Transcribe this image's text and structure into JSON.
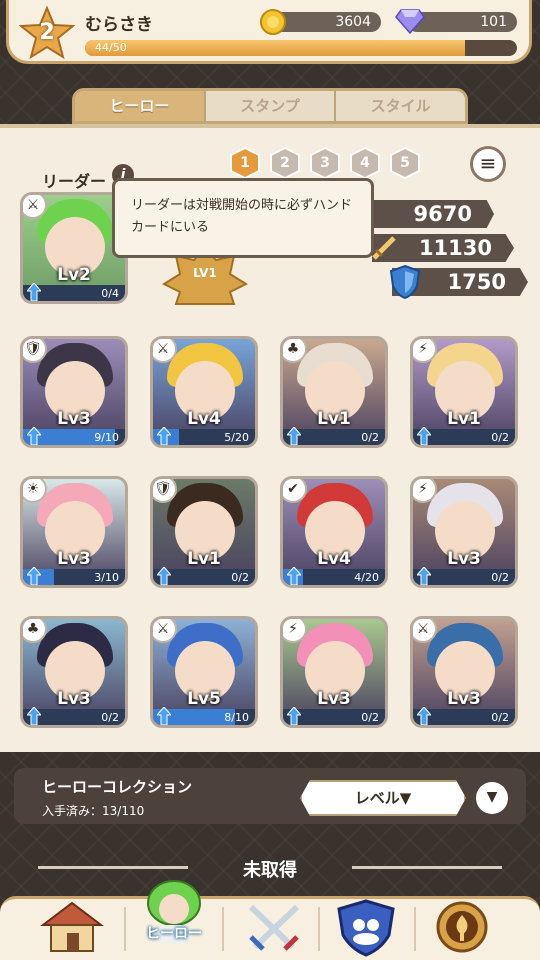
{
  "player": {
    "level": "2",
    "name": "むらさき",
    "exp": "44/50",
    "exp_fraction": 0.88
  },
  "currency": {
    "coins": "3604",
    "gems": "101"
  },
  "tabs": [
    "ヒーロー",
    "スタンプ",
    "スタイル"
  ],
  "leader_label": "リーダー",
  "pages": [
    "1",
    "2",
    "3",
    "4",
    "5"
  ],
  "active_page": "1",
  "leader": {
    "level": "Lv2",
    "count": "0/4",
    "progress": 0.0
  },
  "stats": {
    "hp": "9670",
    "attack": "11130",
    "defense": "1750"
  },
  "tooltip": "リーダーは対戦開始の時に必ずハンドカードにいる",
  "leader_badge": "LV1",
  "heroes": [
    {
      "level": "Lv3",
      "count": "9/10",
      "progress": 0.9,
      "role": "shield",
      "hair": "#3d3548",
      "bg": "#9b8db8"
    },
    {
      "level": "Lv4",
      "count": "5/20",
      "progress": 0.25,
      "role": "sword",
      "hair": "#f2c540",
      "bg": "#78a4d8"
    },
    {
      "level": "Lv1",
      "count": "0/2",
      "progress": 0.0,
      "role": "clover",
      "hair": "#e8ddd0",
      "bg": "#c9a88f"
    },
    {
      "level": "Lv1",
      "count": "0/2",
      "progress": 0.0,
      "role": "bolt",
      "hair": "#f3d58e",
      "bg": "#b29ac9"
    },
    {
      "level": "Lv3",
      "count": "3/10",
      "progress": 0.3,
      "role": "bell",
      "hair": "#f5a8b8",
      "bg": "#d8e8e8"
    },
    {
      "level": "Lv1",
      "count": "0/2",
      "progress": 0.0,
      "role": "shield",
      "hair": "#3b2a20",
      "bg": "#6b7a68"
    },
    {
      "level": "Lv4",
      "count": "4/20",
      "progress": 0.2,
      "role": "heal",
      "hair": "#d23a3a",
      "bg": "#9c8fb8"
    },
    {
      "level": "Lv3",
      "count": "0/2",
      "progress": 0.0,
      "role": "bolt",
      "hair": "#e6e2ea",
      "bg": "#a88a76"
    },
    {
      "level": "Lv3",
      "count": "0/2",
      "progress": 0.0,
      "role": "clover",
      "hair": "#2c2a44",
      "bg": "#8ab8d0"
    },
    {
      "level": "Lv5",
      "count": "8/10",
      "progress": 0.8,
      "role": "sword",
      "hair": "#3e6ec8",
      "bg": "#8eb2d6"
    },
    {
      "level": "Lv3",
      "count": "0/2",
      "progress": 0.0,
      "role": "bolt",
      "hair": "#f290b8",
      "bg": "#a8c890"
    },
    {
      "level": "Lv3",
      "count": "0/2",
      "progress": 0.0,
      "role": "sword",
      "hair": "#3a6ea8",
      "bg": "#c0a090"
    }
  ],
  "collection": {
    "title": "ヒーローコレクション",
    "count": "入手済み：13/110",
    "sort_label": "レベル▼"
  },
  "unacquired": "未取得",
  "nav": {
    "hero_label": "ヒーロー"
  }
}
